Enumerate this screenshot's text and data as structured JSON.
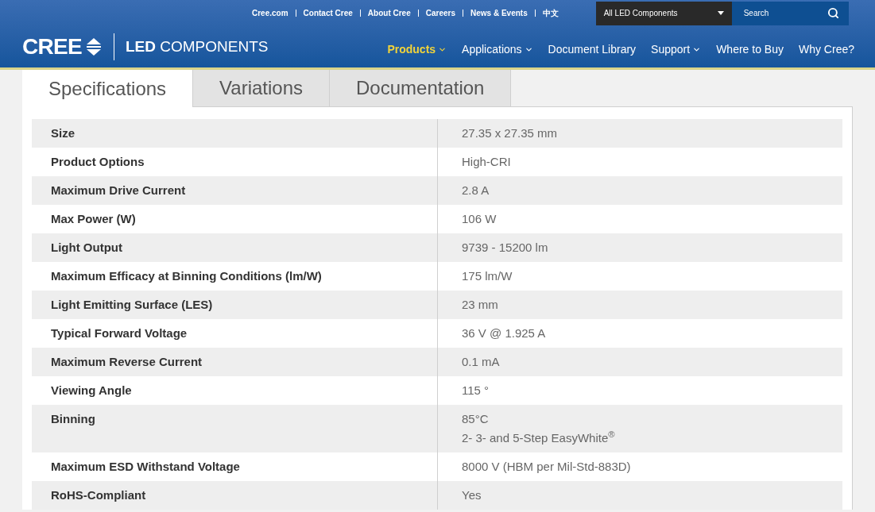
{
  "header": {
    "top_links": [
      {
        "label": "Cree.com"
      },
      {
        "label": "Contact Cree"
      },
      {
        "label": "About Cree"
      },
      {
        "label": "Careers"
      },
      {
        "label": "News & Events"
      },
      {
        "label": "中文"
      }
    ],
    "category_select": {
      "value": "All LED Components"
    },
    "search": {
      "placeholder": "Search"
    },
    "logo": {
      "brand": "CREE",
      "product": "**LED** COMPONENTS"
    },
    "nav": [
      {
        "label": "Products",
        "selected": true,
        "dropdown": true
      },
      {
        "label": "Applications",
        "selected": false,
        "dropdown": true
      },
      {
        "label": "Document Library",
        "selected": false,
        "dropdown": false
      },
      {
        "label": "Support",
        "selected": false,
        "dropdown": true
      },
      {
        "label": "Where to Buy",
        "selected": false,
        "dropdown": false
      },
      {
        "label": "Why Cree?",
        "selected": false,
        "dropdown": false
      }
    ]
  },
  "tabs": [
    {
      "label": "Specifications",
      "selected": true
    },
    {
      "label": "Variations",
      "selected": false
    },
    {
      "label": "Documentation",
      "selected": false
    }
  ],
  "specs": [
    {
      "name": "Size",
      "value": [
        "27.35 x 27.35 mm"
      ]
    },
    {
      "name": "Product Options",
      "value": [
        "High-CRI"
      ]
    },
    {
      "name": "Maximum Drive Current",
      "value": [
        "2.8 A"
      ]
    },
    {
      "name": "Max Power (W)",
      "value": [
        "106 W"
      ]
    },
    {
      "name": "Light Output",
      "value": [
        "9739 - 15200 lm"
      ]
    },
    {
      "name": "Maximum Efficacy at Binning Conditions (lm/W)",
      "value": [
        "175 lm/W"
      ]
    },
    {
      "name": "Light Emitting Surface (LES)",
      "value": [
        "23 mm"
      ]
    },
    {
      "name": "Typical Forward Voltage",
      "value": [
        "36 V @ 1.925 A"
      ]
    },
    {
      "name": "Maximum Reverse Current",
      "value": [
        "0.1 mA"
      ]
    },
    {
      "name": "Viewing Angle",
      "value": [
        "115 °"
      ]
    },
    {
      "name": "Binning",
      "value": [
        "85°C",
        "2- 3- and 5-Step EasyWhite$^{®}$"
      ]
    },
    {
      "name": "Maximum ESD Withstand Voltage",
      "value": [
        "8000 V (HBM per Mil-Std-883D)"
      ]
    },
    {
      "name": "RoHS-Compliant",
      "value": [
        "Yes"
      ]
    }
  ]
}
